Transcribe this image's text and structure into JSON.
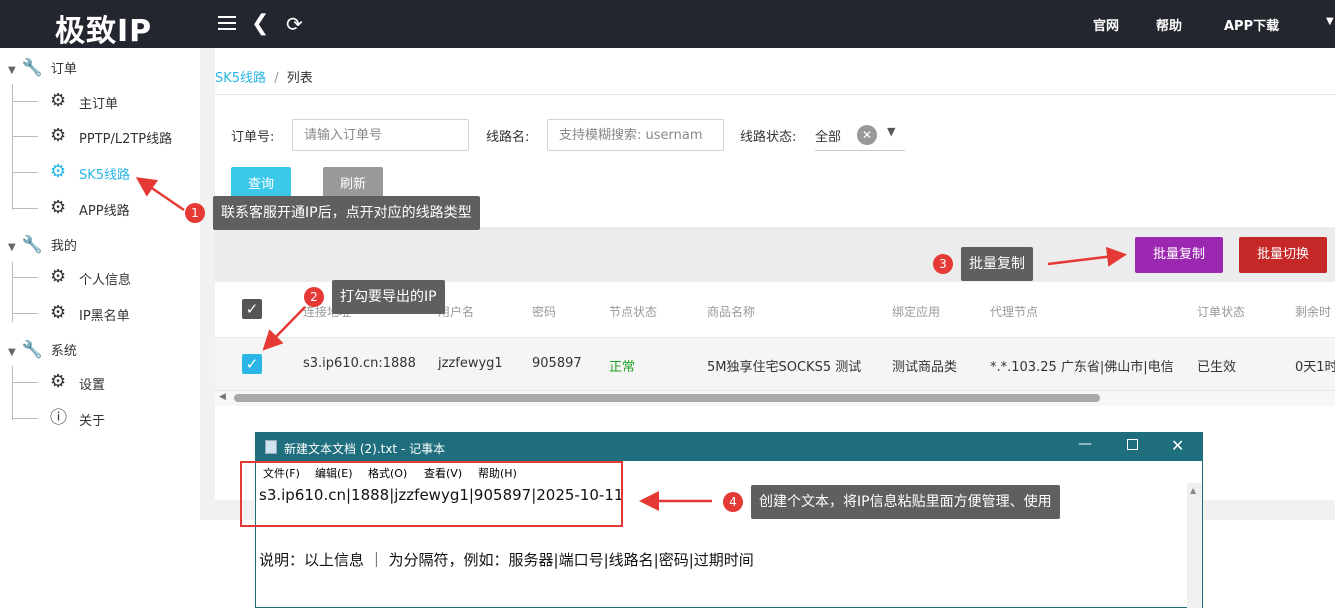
{
  "app": {
    "logo": "极致IP"
  },
  "topbar": {
    "links": [
      "官网",
      "帮助",
      "APP下载"
    ]
  },
  "sidebar": {
    "groups": [
      {
        "label": "订单",
        "items": [
          "主订单",
          "PPTP/L2TP线路",
          "SK5线路",
          "APP线路"
        ]
      },
      {
        "label": "我的",
        "items": [
          "个人信息",
          "IP黑名单"
        ]
      },
      {
        "label": "系统",
        "items": [
          "设置",
          "关于"
        ]
      }
    ]
  },
  "breadcrumb": {
    "parent": "SK5线路",
    "separator": "/",
    "current": "列表"
  },
  "filters": {
    "order_label": "订单号:",
    "order_placeholder": "请输入订单号",
    "route_label": "线路名:",
    "route_placeholder": "支持模糊搜索: usernam",
    "status_label": "线路状态:",
    "status_value": "全部"
  },
  "buttons": {
    "query": "查询",
    "refresh": "刷新",
    "batch_copy": "批量复制",
    "batch_switch": "批量切换"
  },
  "table": {
    "headers": [
      "连接地址",
      "用户名",
      "密码",
      "节点状态",
      "商品名称",
      "绑定应用",
      "代理节点",
      "订单状态",
      "剩余时"
    ],
    "rows": [
      {
        "address": "s3.ip610.cn:1888",
        "username": "jzzfewyg1",
        "password": "905897",
        "node_status": "正常",
        "product": "5M独享住宅SOCKS5 测试",
        "app": "测试商品类",
        "proxy_node": "*.*.103.25 广东省|佛山市|电信",
        "order_status": "已生效",
        "remaining": "0天1时"
      }
    ]
  },
  "notepad": {
    "title": "新建文本文档 (2).txt - 记事本",
    "menu": [
      "文件(F)",
      "编辑(E)",
      "格式(O)",
      "查看(V)",
      "帮助(H)"
    ],
    "line1": "s3.ip610.cn|1888|jzzfewyg1|905897|2025-10-11",
    "line2": "说明：以上信息 ｜ 为分隔符，例如：服务器|端口号|线路名|密码|过期时间"
  },
  "annotations": [
    {
      "num": "1",
      "text": "联系客服开通IP后，点开对应的线路类型"
    },
    {
      "num": "2",
      "text": "打勾要导出的IP"
    },
    {
      "num": "3",
      "text": "批量复制"
    },
    {
      "num": "4",
      "text": "创建个文本，将IP信息粘贴里面方便管理、使用"
    }
  ],
  "colors": {
    "accent": "#29b6e6",
    "batch_copy": "#9c27b0",
    "batch_switch": "#c62828",
    "status_ok": "#22a322",
    "annotation": "#e53935",
    "topbar": "#23262e"
  }
}
